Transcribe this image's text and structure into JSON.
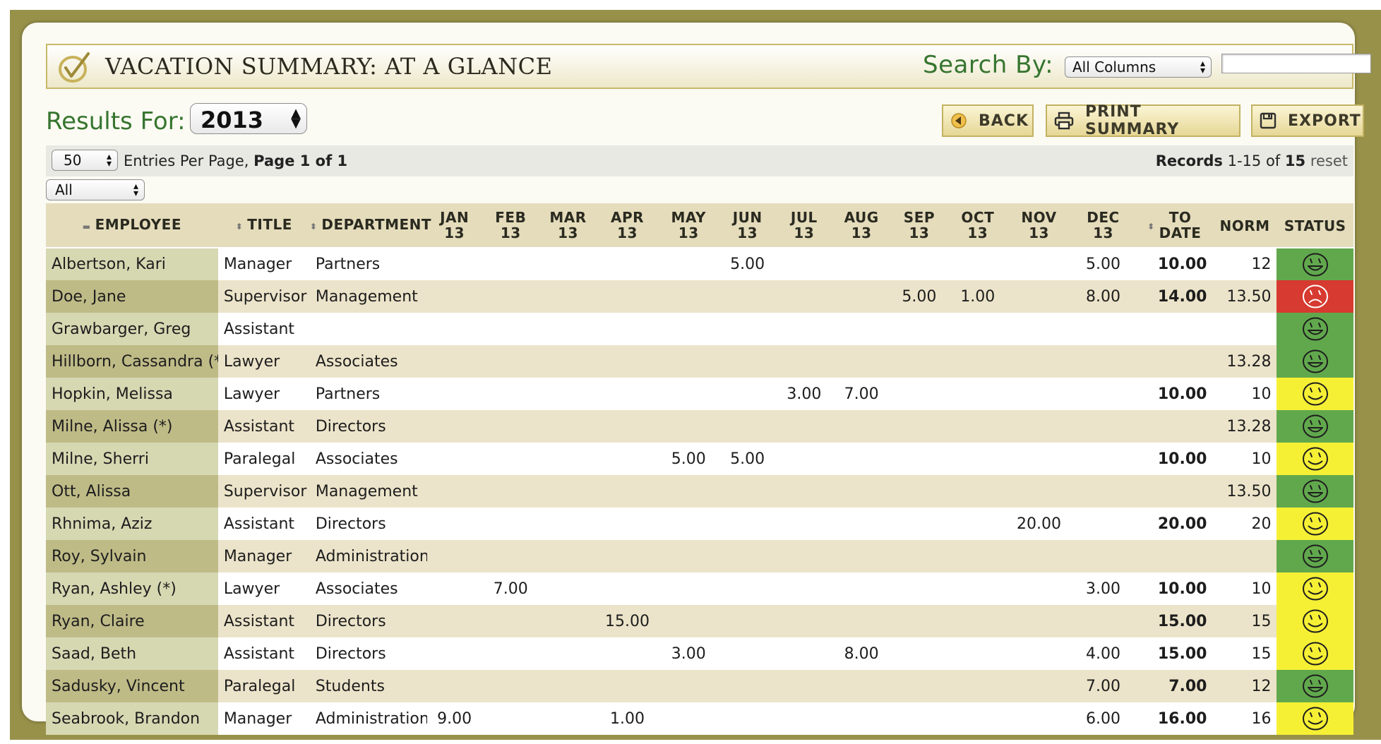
{
  "header": {
    "title": "VACATION SUMMARY: AT A GLANCE",
    "search_label": "Search By:",
    "search_column": "All Columns",
    "search_value": ""
  },
  "results": {
    "label": "Results For:",
    "year": "2013"
  },
  "buttons": {
    "back": "BACK",
    "print": "PRINT SUMMARY",
    "export": "EXPORT"
  },
  "pager": {
    "per_page": "50",
    "entries_text": "Entries Per Page,",
    "page_text": "Page 1 of 1",
    "records_label": "Records",
    "records_range": "1-15 of",
    "records_total": "15",
    "reset": "reset",
    "filter": "All"
  },
  "columns": {
    "employee": "EMPLOYEE",
    "title": "TITLE",
    "department": "DEPARTMENT",
    "months": [
      [
        "JAN",
        "13"
      ],
      [
        "FEB",
        "13"
      ],
      [
        "MAR",
        "13"
      ],
      [
        "APR",
        "13"
      ],
      [
        "MAY",
        "13"
      ],
      [
        "JUN",
        "13"
      ],
      [
        "JUL",
        "13"
      ],
      [
        "AUG",
        "13"
      ],
      [
        "SEP",
        "13"
      ],
      [
        "OCT",
        "13"
      ],
      [
        "NOV",
        "13"
      ],
      [
        "DEC",
        "13"
      ]
    ],
    "to_date": [
      "TO",
      "DATE"
    ],
    "norm": "NORM",
    "status": "STATUS"
  },
  "status_colors": {
    "green": "#61a84d",
    "red": "#d63a30",
    "yellow": "#f6f035"
  },
  "rows": [
    {
      "employee": "Albertson, Kari",
      "title": "Manager",
      "department": "Partners",
      "months": [
        "",
        "",
        "",
        "",
        "",
        "5.00",
        "",
        "",
        "",
        "",
        "",
        "5.00"
      ],
      "to_date": "10.00",
      "norm": "12",
      "status": "green"
    },
    {
      "employee": "Doe, Jane",
      "title": "Supervisor",
      "department": "Management",
      "months": [
        "",
        "",
        "",
        "",
        "",
        "",
        "",
        "",
        "5.00",
        "1.00",
        "",
        "8.00"
      ],
      "to_date": "14.00",
      "norm": "13.50",
      "status": "red"
    },
    {
      "employee": "Grawbarger, Greg",
      "title": "Assistant",
      "department": "",
      "months": [
        "",
        "",
        "",
        "",
        "",
        "",
        "",
        "",
        "",
        "",
        "",
        ""
      ],
      "to_date": "",
      "norm": "",
      "status": "green"
    },
    {
      "employee": "Hillborn, Cassandra (*)",
      "title": "Lawyer",
      "department": "Associates",
      "months": [
        "",
        "",
        "",
        "",
        "",
        "",
        "",
        "",
        "",
        "",
        "",
        ""
      ],
      "to_date": "",
      "norm": "13.28",
      "status": "green"
    },
    {
      "employee": "Hopkin, Melissa",
      "title": "Lawyer",
      "department": "Partners",
      "months": [
        "",
        "",
        "",
        "",
        "",
        "",
        "3.00",
        "7.00",
        "",
        "",
        "",
        ""
      ],
      "to_date": "10.00",
      "norm": "10",
      "status": "yellow"
    },
    {
      "employee": "Milne, Alissa (*)",
      "title": "Assistant",
      "department": "Directors",
      "months": [
        "",
        "",
        "",
        "",
        "",
        "",
        "",
        "",
        "",
        "",
        "",
        ""
      ],
      "to_date": "",
      "norm": "13.28",
      "status": "green"
    },
    {
      "employee": "Milne, Sherri",
      "title": "Paralegal",
      "department": "Associates",
      "months": [
        "",
        "",
        "",
        "",
        "5.00",
        "5.00",
        "",
        "",
        "",
        "",
        "",
        ""
      ],
      "to_date": "10.00",
      "norm": "10",
      "status": "yellow"
    },
    {
      "employee": "Ott, Alissa",
      "title": "Supervisor",
      "department": "Management",
      "months": [
        "",
        "",
        "",
        "",
        "",
        "",
        "",
        "",
        "",
        "",
        "",
        ""
      ],
      "to_date": "",
      "norm": "13.50",
      "status": "green"
    },
    {
      "employee": "Rhnima, Aziz",
      "title": "Assistant",
      "department": "Directors",
      "months": [
        "",
        "",
        "",
        "",
        "",
        "",
        "",
        "",
        "",
        "",
        "20.00",
        ""
      ],
      "to_date": "20.00",
      "norm": "20",
      "status": "yellow"
    },
    {
      "employee": "Roy, Sylvain",
      "title": "Manager",
      "department": "Administration",
      "months": [
        "",
        "",
        "",
        "",
        "",
        "",
        "",
        "",
        "",
        "",
        "",
        ""
      ],
      "to_date": "",
      "norm": "",
      "status": "green"
    },
    {
      "employee": "Ryan, Ashley (*)",
      "title": "Lawyer",
      "department": "Associates",
      "months": [
        "",
        "7.00",
        "",
        "",
        "",
        "",
        "",
        "",
        "",
        "",
        "",
        "3.00"
      ],
      "to_date": "10.00",
      "norm": "10",
      "status": "yellow"
    },
    {
      "employee": "Ryan, Claire",
      "title": "Assistant",
      "department": "Directors",
      "months": [
        "",
        "",
        "",
        "15.00",
        "",
        "",
        "",
        "",
        "",
        "",
        "",
        ""
      ],
      "to_date": "15.00",
      "norm": "15",
      "status": "yellow"
    },
    {
      "employee": "Saad, Beth",
      "title": "Assistant",
      "department": "Directors",
      "months": [
        "",
        "",
        "",
        "",
        "3.00",
        "",
        "",
        "8.00",
        "",
        "",
        "",
        "4.00"
      ],
      "to_date": "15.00",
      "norm": "15",
      "status": "yellow"
    },
    {
      "employee": "Sadusky, Vincent",
      "title": "Paralegal",
      "department": "Students",
      "months": [
        "",
        "",
        "",
        "",
        "",
        "",
        "",
        "",
        "",
        "",
        "",
        "7.00"
      ],
      "to_date": "7.00",
      "norm": "12",
      "status": "green"
    },
    {
      "employee": "Seabrook, Brandon",
      "title": "Manager",
      "department": "Administration",
      "months": [
        "9.00",
        "",
        "",
        "1.00",
        "",
        "",
        "",
        "",
        "",
        "",
        "",
        "6.00"
      ],
      "to_date": "16.00",
      "norm": "16",
      "status": "yellow"
    }
  ]
}
